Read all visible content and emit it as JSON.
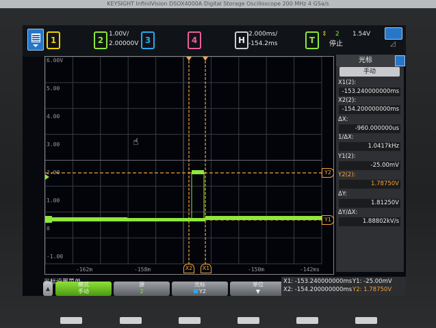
{
  "bezel": {
    "label": "KEYSIGHT  InfiniiVision DSOX4000A  Digital Storage Oscilloscope  200 MHz  4 GSa/s"
  },
  "status": {
    "ch1": "1",
    "ch2": "2",
    "ch2_scale": "1.00V/",
    "ch2_offset": "2.00000V",
    "ch3": "3",
    "ch4": "4",
    "horiz_label": "H",
    "time_scale": "2.000ms/",
    "time_delay": "-154.2ms",
    "trig_label": "T",
    "trig_source": "2",
    "trig_level": "1.54V",
    "trig_state": "停止"
  },
  "graticule": {
    "y_labels": [
      "6.00V",
      "5.00",
      "4.00",
      "3.00",
      "2.00",
      "1.00",
      "0",
      "-1.00"
    ],
    "x_labels": [
      "-162m",
      "-158m",
      "-150m",
      "-142ms"
    ],
    "marker_y1": "Y1",
    "marker_y2": "Y2",
    "marker_x1": "X1",
    "marker_x2": "X2"
  },
  "cursor_panel": {
    "title": "光标",
    "mode": "手动",
    "x1_label": "X1(2):",
    "x1_value": "-153.240000000ms",
    "x2_label": "X2(2):",
    "x2_value": "-154.200000000ms",
    "dx_label": "ΔX:",
    "dx_value": "-960.000000us",
    "inv_dx_label": "1/ΔX:",
    "inv_dx_value": "1.0417kHz",
    "y1_label": "Y1(2):",
    "y1_value": "-25.00mV",
    "y2_label": "Y2(2):",
    "y2_value": "1.78750V",
    "dy_label": "ΔY:",
    "dy_value": "1.81250V",
    "dydx_label": "ΔY/ΔX:",
    "dydx_value": "1.88802kV/s"
  },
  "softkeys": {
    "menu_title": "光标设置菜单",
    "mode_label": "模式",
    "mode_value": "手动",
    "source_label": "源",
    "source_value": "2",
    "cursor_label": "光标",
    "cursor_value": "Y2",
    "units_label": "单位"
  },
  "readout": {
    "x1": "X1: -153.240000000ms",
    "x2": "X2: -154.200000000ms",
    "y1": "Y1: -25.00mV",
    "y2": "Y2: 1.78750V"
  },
  "colors": {
    "ch1": "#f5d000",
    "ch2": "#8fe83a",
    "ch3": "#2ea8f0",
    "ch4": "#f05c9b",
    "cursor": "#f5a53c"
  }
}
